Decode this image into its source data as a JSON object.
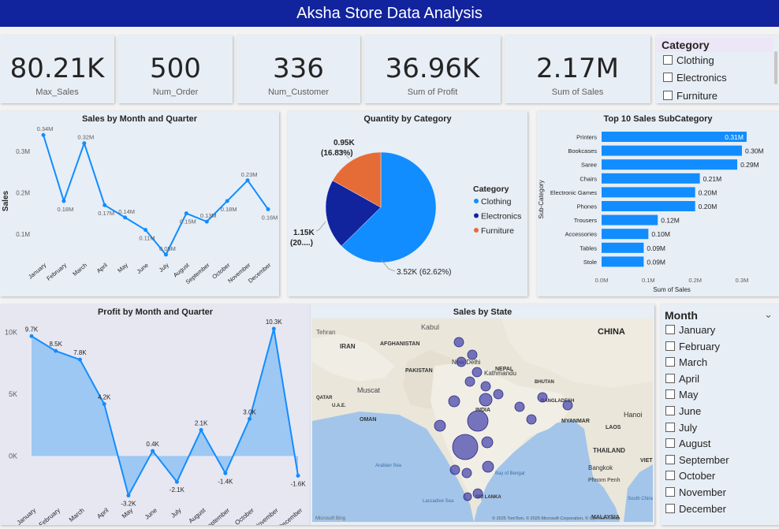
{
  "header": {
    "title": "Aksha Store Data Analysis"
  },
  "kpis": [
    {
      "value": "80.21K",
      "label": "Max_Sales"
    },
    {
      "value": "500",
      "label": "Num_Order"
    },
    {
      "value": "336",
      "label": "Num_Customer"
    },
    {
      "value": "36.96K",
      "label": "Sum of Profit"
    },
    {
      "value": "2.17M",
      "label": "Sum of Sales"
    }
  ],
  "category_slicer": {
    "title": "Category",
    "items": [
      "Clothing",
      "Electronics",
      "Furniture"
    ]
  },
  "month_slicer": {
    "title": "Month",
    "items": [
      "January",
      "February",
      "March",
      "April",
      "May",
      "June",
      "July",
      "August",
      "September",
      "October",
      "November",
      "December"
    ]
  },
  "colors": {
    "header": "#12239e",
    "blue": "#118dff",
    "navy": "#12239e",
    "orange": "#e66c37",
    "bubble": "#3f3fa8"
  },
  "chart_data": [
    {
      "id": "sales_month",
      "type": "line",
      "title": "Sales by Month and Quarter",
      "ylabel": "Sales",
      "ylim": [
        0.05,
        0.35
      ],
      "y_ticks": [
        "0.1M",
        "0.2M",
        "0.3M"
      ],
      "y_tick_values": [
        0.1,
        0.2,
        0.3
      ],
      "categories": [
        "January",
        "February",
        "March",
        "April",
        "May",
        "June",
        "July",
        "August",
        "September",
        "October",
        "November",
        "December"
      ],
      "values": [
        0.34,
        0.18,
        0.32,
        0.17,
        0.14,
        0.11,
        0.05,
        0.15,
        0.13,
        0.18,
        0.23,
        0.16
      ],
      "labels": [
        "0.34M",
        "0.18M",
        "0.32M",
        "0.17M",
        "0.14M",
        "0.11M",
        "0.05M",
        "0.15M",
        "0.13M",
        "0.18M",
        "0.23M",
        "0.16M"
      ]
    },
    {
      "id": "qty_category",
      "type": "pie",
      "title": "Quantity by Category",
      "legend_title": "Category",
      "slices": [
        {
          "name": "Clothing",
          "value": 3.52,
          "label": "3.52K (62.62%)",
          "color": "#118dff"
        },
        {
          "name": "Electronics",
          "value": 1.15,
          "label_line1": "1.15K",
          "label_line2": "(20....)",
          "color": "#12239e"
        },
        {
          "name": "Furniture",
          "value": 0.95,
          "label_line1": "0.95K",
          "label_line2": "(16.83%)",
          "color": "#e66c37"
        }
      ]
    },
    {
      "id": "top_subcat",
      "type": "bar",
      "title": "Top 10 Sales SubCategory",
      "xlabel": "Sum of Sales",
      "ylabel": "Sub-Category",
      "xlim": [
        0,
        0.3
      ],
      "x_ticks": [
        "0.0M",
        "0.1M",
        "0.2M",
        "0.3M"
      ],
      "x_tick_values": [
        0,
        0.1,
        0.2,
        0.3
      ],
      "categories": [
        "Printers",
        "Bookcases",
        "Saree",
        "Chairs",
        "Electronic Games",
        "Phones",
        "Trousers",
        "Accessories",
        "Tables",
        "Stole"
      ],
      "values": [
        0.31,
        0.3,
        0.29,
        0.21,
        0.2,
        0.2,
        0.12,
        0.1,
        0.09,
        0.09
      ],
      "labels": [
        "0.31M",
        "0.30M",
        "0.29M",
        "0.21M",
        "0.20M",
        "0.20M",
        "0.12M",
        "0.10M",
        "0.09M",
        "0.09M"
      ]
    },
    {
      "id": "profit_month",
      "type": "area",
      "title": "Profit by Month and Quarter",
      "ylim": [
        -4,
        11
      ],
      "y_ticks": [
        "0K",
        "5K",
        "10K"
      ],
      "y_tick_values": [
        0,
        5,
        10
      ],
      "categories": [
        "January",
        "February",
        "March",
        "April",
        "May",
        "June",
        "July",
        "August",
        "September",
        "October",
        "November",
        "December"
      ],
      "values": [
        9.7,
        8.5,
        7.8,
        4.2,
        -3.2,
        0.4,
        -2.1,
        2.1,
        -1.4,
        3.0,
        10.3,
        -1.6
      ],
      "labels": [
        "9.7K",
        "8.5K",
        "7.8K",
        "4.2K",
        "-3.2K",
        "0.4K",
        "-2.1K",
        "2.1K",
        "-1.4K",
        "3.0K",
        "10.3K",
        "-1.6K"
      ]
    }
  ],
  "map": {
    "title": "Sales by State",
    "labels": [
      "Kabul",
      "Tehran",
      "IRAN",
      "AFGHANISTAN",
      "PAKISTAN",
      "New Delhi",
      "NEPAL",
      "Kathmandu",
      "BHUTAN",
      "BANGLADESH",
      "INDIA",
      "MYANMAR",
      "CHINA",
      "Muscat",
      "OMAN",
      "QATAR",
      "U.A.E.",
      "Hanoi",
      "LAOS",
      "THAILAND",
      "Bangkok",
      "VIETN",
      "Arabian Sea",
      "Bay of Bengal",
      "Laccadive Sea",
      "SRI LANKA",
      "Phnom Penh",
      "South China Sea",
      "MALAYSIA"
    ],
    "attribution": "© 2025 TomTom, © 2025 Microsoft Corporation, © OpenStreetMap",
    "brand": "Microsoft Bing"
  }
}
